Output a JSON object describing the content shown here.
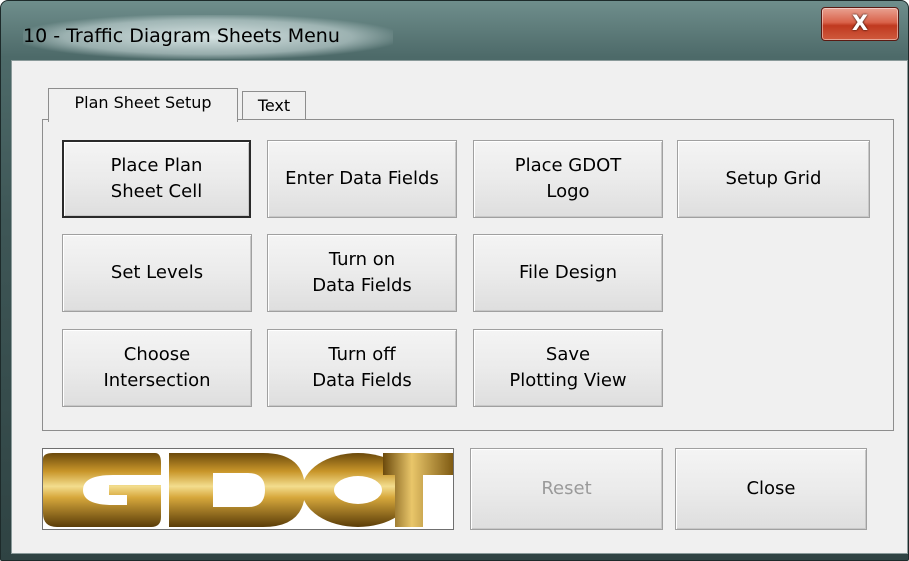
{
  "window": {
    "title": "10 - Traffic Diagram Sheets Menu",
    "close_glyph": "X"
  },
  "tabs": [
    {
      "label": "Plan Sheet Setup",
      "active": true
    },
    {
      "label": "Text",
      "active": false
    }
  ],
  "buttons": {
    "place_plan_sheet_cell": "Place Plan\nSheet Cell",
    "enter_data_fields": "Enter Data Fields",
    "place_gdot_logo": "Place GDOT\nLogo",
    "setup_grid": "Setup Grid",
    "set_levels": "Set Levels",
    "turn_on_data_fields": "Turn on\nData Fields",
    "file_design": "File Design",
    "choose_intersection": "Choose\nIntersection",
    "turn_off_data_fields": "Turn off\nData Fields",
    "save_plotting_view": "Save\nPlotting View",
    "reset": "Reset",
    "close": "Close"
  },
  "logo": {
    "text": "GDOT",
    "colors": {
      "gold_light": "#e9c66a",
      "gold": "#c9962a",
      "gold_dark": "#6b4a0c"
    }
  },
  "colors": {
    "dialog_bg": "#f0f0f0",
    "frame": "#3e5656",
    "close_red": "#c0391f",
    "disabled_text": "#9a9a9a"
  }
}
